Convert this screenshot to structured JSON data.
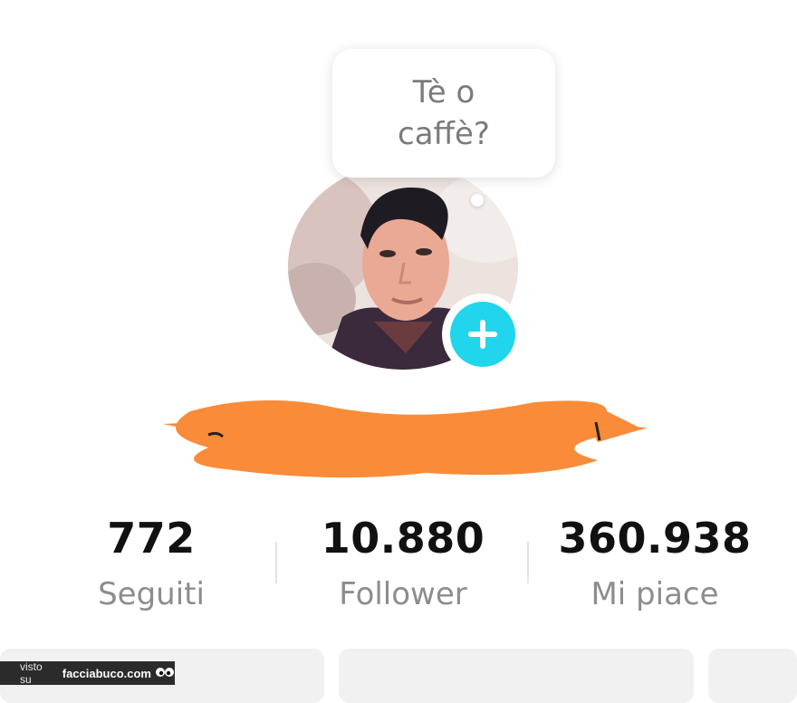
{
  "speech_bubble": {
    "text": "Tè o\ncaffè?"
  },
  "avatar": {
    "alt": "profile photo"
  },
  "follow_button": {
    "icon": "plus-icon",
    "color": "#20d5ec"
  },
  "username": {
    "redacted": true,
    "redaction_color": "#fa8b39"
  },
  "stats": [
    {
      "value": "772",
      "label": "Seguiti"
    },
    {
      "value": "10.880",
      "label": "Follower"
    },
    {
      "value": "360.938",
      "label": "Mi piace"
    }
  ],
  "watermark": {
    "prefix": "visto su",
    "site": "facciabuco.com"
  }
}
